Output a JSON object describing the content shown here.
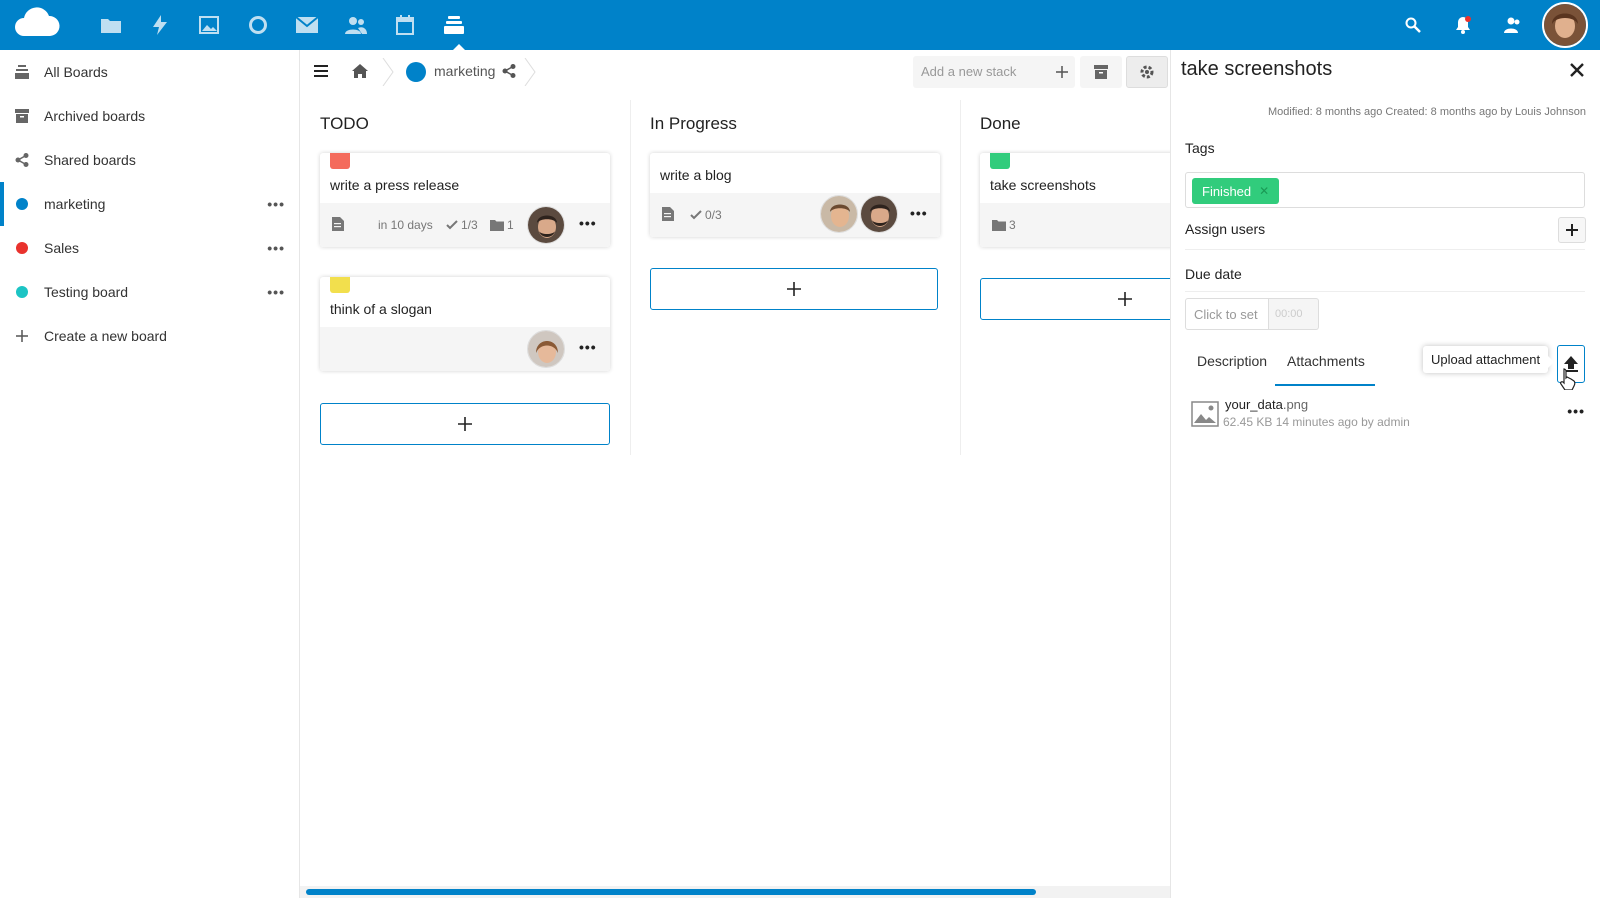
{
  "topbar": {
    "apps": [
      {
        "name": "files-icon"
      },
      {
        "name": "activity-icon"
      },
      {
        "name": "photos-icon"
      },
      {
        "name": "talk-icon"
      },
      {
        "name": "mail-icon"
      },
      {
        "name": "contacts-icon"
      },
      {
        "name": "calendar-icon"
      },
      {
        "name": "deck-icon"
      }
    ],
    "accent": "#0082c9"
  },
  "sidebar": {
    "items": [
      {
        "label": "All Boards",
        "icon": "all-boards-icon"
      },
      {
        "label": "Archived boards",
        "icon": "archive-icon"
      },
      {
        "label": "Shared boards",
        "icon": "share-icon"
      },
      {
        "label": "marketing",
        "color": "#0082c9"
      },
      {
        "label": "Sales",
        "color": "#e9322d"
      },
      {
        "label": "Testing board",
        "color": "#1cc4c4"
      },
      {
        "label": "Create a new board",
        "icon": "plus-icon"
      }
    ],
    "menu_glyph": "•••"
  },
  "controls": {
    "board_name": "marketing",
    "stack_placeholder": "Add a new stack"
  },
  "stacks": [
    {
      "title": "TODO",
      "cards": [
        {
          "title": "write a press release",
          "label_color": "#f46b5c",
          "due": "in 10 days",
          "checklist": "1/3",
          "attachments": "1"
        },
        {
          "title": "think of a slogan",
          "label_color": "#f2df4d"
        }
      ]
    },
    {
      "title": "In Progress",
      "cards": [
        {
          "title": "write a blog",
          "checklist": "0/3"
        }
      ]
    },
    {
      "title": "Done",
      "cards": [
        {
          "title": "take screenshots",
          "label_color": "#31cc7c",
          "attachments": "3"
        }
      ]
    }
  ],
  "details": {
    "title": "take screenshots",
    "meta": "Modified: 8 months ago Created: 8 months ago by Louis Johnson",
    "tags_label": "Tags",
    "tag": "Finished",
    "tag_color": "#31cc7c",
    "assign_label": "Assign users",
    "due_label": "Due date",
    "due_placeholder": "Click to set",
    "time_placeholder": "00:00",
    "tabs": [
      "Description",
      "Attachments"
    ],
    "tooltip": "Upload attachment",
    "attachment": {
      "basename": "your_data",
      "ext": ".png",
      "meta": "62.45 KB 14 minutes ago by admin"
    }
  }
}
